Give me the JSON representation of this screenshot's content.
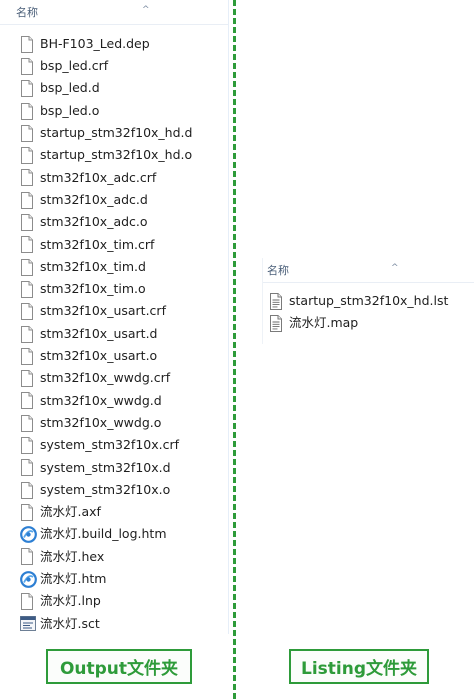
{
  "output_panel": {
    "column_header": "名称",
    "files": [
      {
        "name": "BH-F103_Led.dep",
        "icon": "file-icon"
      },
      {
        "name": "bsp_led.crf",
        "icon": "file-icon"
      },
      {
        "name": "bsp_led.d",
        "icon": "file-icon"
      },
      {
        "name": "bsp_led.o",
        "icon": "file-icon"
      },
      {
        "name": "startup_stm32f10x_hd.d",
        "icon": "file-icon"
      },
      {
        "name": "startup_stm32f10x_hd.o",
        "icon": "file-icon"
      },
      {
        "name": "stm32f10x_adc.crf",
        "icon": "file-icon"
      },
      {
        "name": "stm32f10x_adc.d",
        "icon": "file-icon"
      },
      {
        "name": "stm32f10x_adc.o",
        "icon": "file-icon"
      },
      {
        "name": "stm32f10x_tim.crf",
        "icon": "file-icon"
      },
      {
        "name": "stm32f10x_tim.d",
        "icon": "file-icon"
      },
      {
        "name": "stm32f10x_tim.o",
        "icon": "file-icon"
      },
      {
        "name": "stm32f10x_usart.crf",
        "icon": "file-icon"
      },
      {
        "name": "stm32f10x_usart.d",
        "icon": "file-icon"
      },
      {
        "name": "stm32f10x_usart.o",
        "icon": "file-icon"
      },
      {
        "name": "stm32f10x_wwdg.crf",
        "icon": "file-icon"
      },
      {
        "name": "stm32f10x_wwdg.d",
        "icon": "file-icon"
      },
      {
        "name": "stm32f10x_wwdg.o",
        "icon": "file-icon"
      },
      {
        "name": "system_stm32f10x.crf",
        "icon": "file-icon"
      },
      {
        "name": "system_stm32f10x.d",
        "icon": "file-icon"
      },
      {
        "name": "system_stm32f10x.o",
        "icon": "file-icon"
      },
      {
        "name": "流水灯.axf",
        "icon": "file-icon"
      },
      {
        "name": "流水灯.build_log.htm",
        "icon": "browser-icon"
      },
      {
        "name": "流水灯.hex",
        "icon": "file-icon"
      },
      {
        "name": "流水灯.htm",
        "icon": "browser-icon"
      },
      {
        "name": "流水灯.lnp",
        "icon": "file-icon"
      },
      {
        "name": "流水灯.sct",
        "icon": "script-icon"
      }
    ]
  },
  "listing_panel": {
    "column_header": "名称",
    "files": [
      {
        "name": "startup_stm32f10x_hd.lst",
        "icon": "text-file-icon"
      },
      {
        "name": "流水灯.map",
        "icon": "text-file-icon"
      }
    ]
  },
  "labels": {
    "output": "Output文件夹",
    "listing": "Listing文件夹"
  },
  "colors": {
    "accent_green": "#2e9b3a",
    "header_text": "#4c607a",
    "file_text": "#1e1e1e"
  }
}
